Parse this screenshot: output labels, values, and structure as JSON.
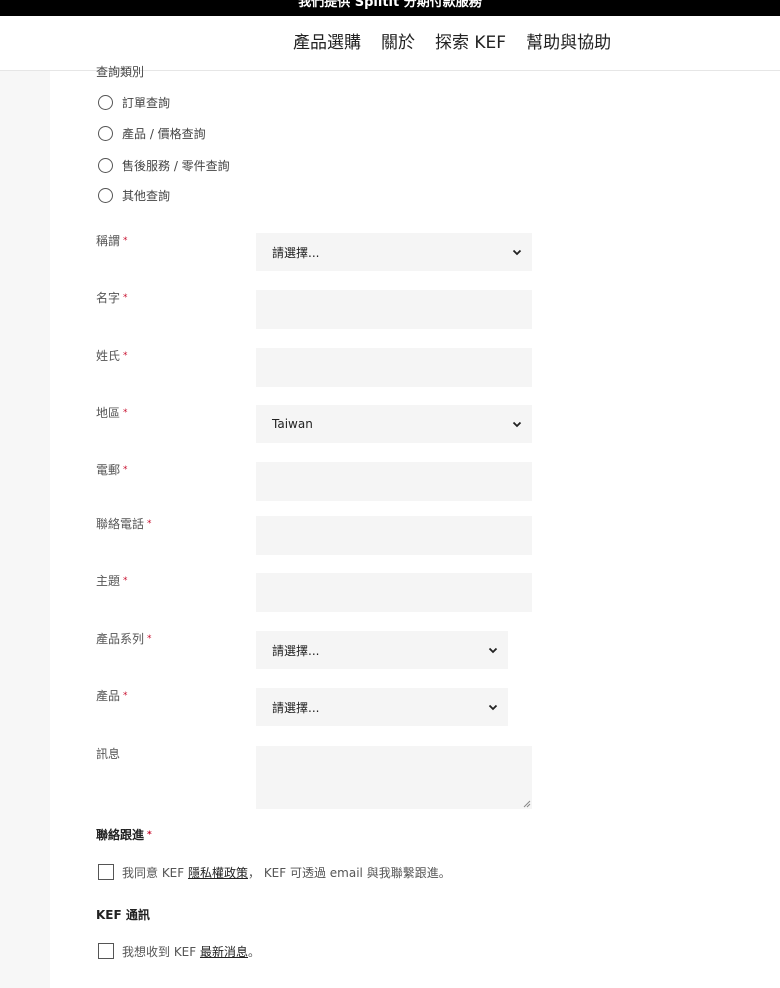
{
  "announcement": "我們提供 Splitit 分期付款服務",
  "nav": {
    "products": "產品選購",
    "about": "關於",
    "explore": "探索 KEF",
    "help": "幫助與協助"
  },
  "form": {
    "inquiry_type": {
      "label": "查詢類別",
      "options": [
        "訂單查詢",
        "產品 / 價格查詢",
        "售後服務 / 零件查詢",
        "其他查詢"
      ]
    },
    "required_mark": "*",
    "salutation": {
      "label": "稱謂",
      "value": "請選擇..."
    },
    "first_name": {
      "label": "名字",
      "value": ""
    },
    "last_name": {
      "label": "姓氏",
      "value": ""
    },
    "region": {
      "label": "地區",
      "value": "Taiwan"
    },
    "email": {
      "label": "電郵",
      "value": ""
    },
    "phone": {
      "label": "聯絡電話",
      "value": ""
    },
    "subject": {
      "label": "主題",
      "value": ""
    },
    "product_series": {
      "label": "產品系列",
      "value": "請選擇..."
    },
    "product": {
      "label": "產品",
      "value": "請選擇..."
    },
    "message": {
      "label": "訊息",
      "value": ""
    },
    "follow_up": {
      "title": "聯絡跟進",
      "text_before": "我同意 KEF ",
      "link": "隱私權政策",
      "text_after": "， KEF 可透過 email 與我聯繫跟進。"
    },
    "newsletter": {
      "title": "KEF 通訊",
      "text_before": "我想收到 KEF ",
      "link": "最新消息",
      "text_after": "。"
    }
  }
}
